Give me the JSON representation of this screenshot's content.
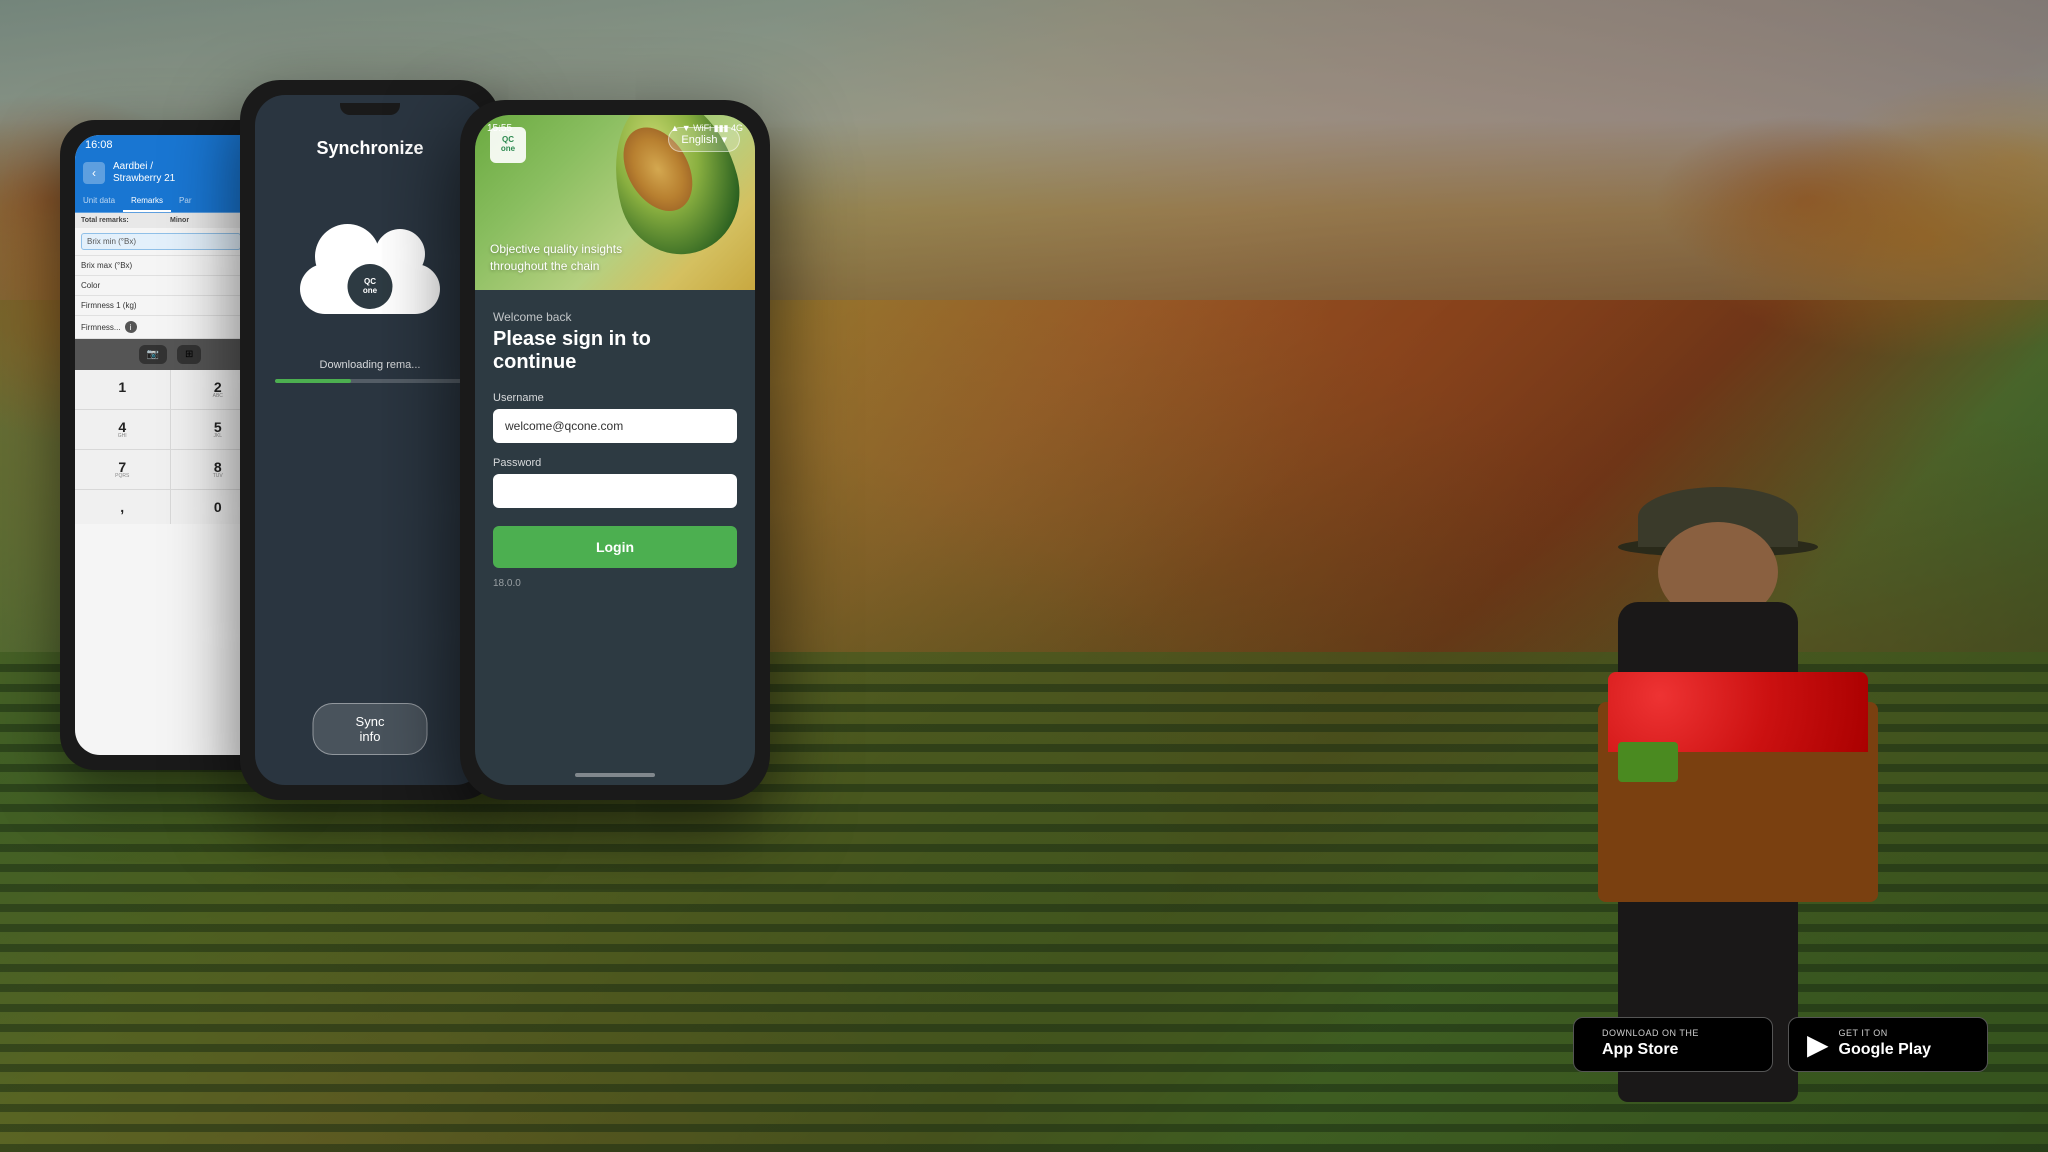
{
  "background": {
    "description": "Autumn farm field with strawberry workers"
  },
  "phone1": {
    "status_bar": {
      "time": "16:08"
    },
    "nav": {
      "back_label": "‹",
      "title_line1": "Aardbei /",
      "title_line2": "Strawberry 21"
    },
    "tabs": [
      {
        "label": "Unit data",
        "active": false
      },
      {
        "label": "Remarks",
        "active": false
      },
      {
        "label": "Par",
        "active": false
      }
    ],
    "table_header": {
      "col1": "Total remarks:",
      "col2": "Minor"
    },
    "rows": [
      {
        "label": "Brix min (°Bx)",
        "has_input": true
      },
      {
        "label": "Brix max (°Bx)",
        "has_input": false
      },
      {
        "label": "Color",
        "has_input": false
      },
      {
        "label": "Firmness 1 (kg)",
        "has_input": false
      },
      {
        "label": "Firmness...",
        "has_input": false
      }
    ],
    "keypad": {
      "keys": [
        {
          "number": "1",
          "letters": ""
        },
        {
          "number": "2",
          "letters": "ABC"
        },
        {
          "number": "4",
          "letters": "GHI"
        },
        {
          "number": "5",
          "letters": "JKL"
        },
        {
          "number": "7",
          "letters": "PQRS"
        },
        {
          "number": "8",
          "letters": "TUV"
        },
        {
          "number": ",",
          "letters": ""
        },
        {
          "number": "0",
          "letters": ""
        }
      ]
    }
  },
  "phone2": {
    "title": "Synchronize",
    "cloud_icon": "☁",
    "qc_logo_text": "QC\none",
    "downloading_text": "Downloading rema...",
    "progress_percent": 40,
    "sync_button_label": "Sync info"
  },
  "phone3": {
    "status_bar": {
      "time": "15:55",
      "wifi": "WiFi",
      "battery": "4G"
    },
    "banner": {
      "tagline_line1": "Objective quality insights",
      "tagline_line2": "throughout the chain"
    },
    "language_button": "English",
    "qc_logo_line1": "QC",
    "qc_logo_line2": "one",
    "login": {
      "welcome_text": "Welcome back",
      "title": "Please sign in to continue",
      "username_label": "Username",
      "username_placeholder": "welcome@qcone.com",
      "username_value": "welcome@qcone.com",
      "password_label": "Password",
      "password_value": "",
      "login_button_label": "Login",
      "version": "18.0.0"
    }
  },
  "app_store": {
    "apple": {
      "sub_label": "Download on the",
      "main_label": "App Store"
    },
    "google": {
      "sub_label": "GET IT ON",
      "main_label": "Google Play"
    }
  }
}
